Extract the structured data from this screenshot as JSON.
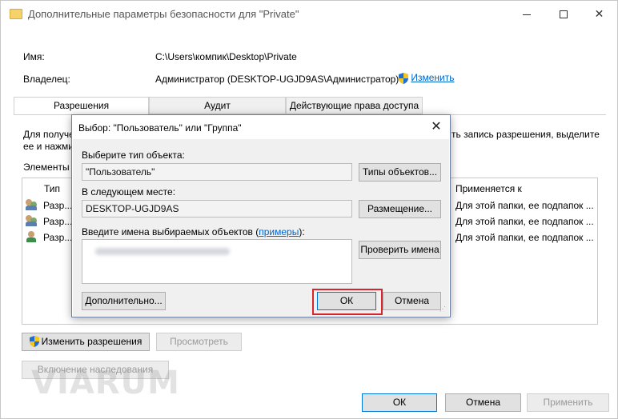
{
  "window": {
    "title": "Дополнительные параметры безопасности  для \"Private\""
  },
  "info": {
    "name_label": "Имя:",
    "name_value": "C:\\Users\\компик\\Desktop\\Private",
    "owner_label": "Владелец:",
    "owner_value": "Администратор (DESKTOP-UGJD9AS\\Администратор)",
    "owner_change_link": "Изменить"
  },
  "tabs": [
    {
      "label": "Разрешения",
      "active": true
    },
    {
      "label": "Аудит",
      "active": false
    },
    {
      "label": "Действующие права доступа",
      "active": false
    }
  ],
  "panel": {
    "intro_line1_left": "Для получе",
    "intro_line1_right": "ть запись разрешения, выделите",
    "intro_line2_left": "ее и нажми",
    "elements_label": "Элементы р",
    "col_type": "Тип",
    "col_applies": "Применяется к",
    "rows": [
      {
        "type": "Разр...",
        "applies": "Для этой папки, ее подпапок ..."
      },
      {
        "type": "Разр...",
        "applies": "Для этой папки, ее подпапок ..."
      },
      {
        "type": "Разр...",
        "applies": "Для этой папки, ее подпапок ..."
      }
    ],
    "change_perms_button": "Изменить разрешения",
    "view_button": "Просмотреть",
    "enable_inheritance_button": "Включение наследования"
  },
  "footer": {
    "ok": "ОК",
    "cancel": "Отмена",
    "apply": "Применить"
  },
  "dialog": {
    "title": "Выбор: \"Пользователь\" или \"Группа\"",
    "object_type_label": "Выберите тип объекта:",
    "object_type_value": "\"Пользователь\"",
    "object_types_button": "Типы объектов...",
    "location_label": "В следующем месте:",
    "location_value": "DESKTOP-UGJD9AS",
    "location_button": "Размещение...",
    "names_label_prefix": "Введите имена выбираемых объектов (",
    "names_label_link": "примеры",
    "names_label_suffix": "):",
    "check_names_button": "Проверить имена",
    "advanced_button": "Дополнительно...",
    "ok_button": "ОК",
    "cancel_button": "Отмена"
  },
  "watermark": "VIARUM",
  "colors": {
    "accent": "#0078d7",
    "link": "#0066cc",
    "highlight": "#d9252b"
  }
}
